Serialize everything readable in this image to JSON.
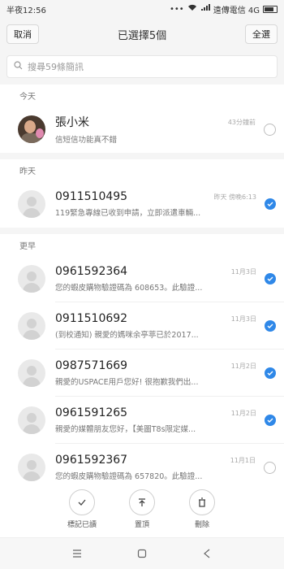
{
  "status": {
    "time": "半夜12:56",
    "carrier": "遠傳電信 4G"
  },
  "header": {
    "cancel_label": "取消",
    "title": "已選擇5個",
    "select_all_label": "全選"
  },
  "search": {
    "placeholder": "搜尋59條簡訊"
  },
  "sections": {
    "today": "今天",
    "yesterday": "昨天",
    "earlier": "更早"
  },
  "messages": [
    {
      "name": "張小米",
      "preview": "信短信功能真不錯",
      "time": "43分鐘前",
      "selected": false
    },
    {
      "name": "0911510495",
      "preview": "119緊急專線已收到申請，立即派遣車輛...",
      "time": "昨天 傍晚6:13",
      "selected": true
    },
    {
      "name": "0961592364",
      "preview": "您的蝦皮購物驗證碼為 608653。此驗證...",
      "time": "11月3日",
      "selected": true
    },
    {
      "name": "0911510692",
      "preview": "(到校通知) 親愛的媽咪余亭葶已於2017...",
      "time": "11月3日",
      "selected": true
    },
    {
      "name": "0987571669",
      "preview": "親愛的USPACE用戶您好! 很抱歉我們出...",
      "time": "11月2日",
      "selected": true
    },
    {
      "name": "0961591265",
      "preview": "親愛的媒體朋友您好，【美圖T8s限定媒...",
      "time": "11月2日",
      "selected": true
    },
    {
      "name": "0961592367",
      "preview": "您的蝦皮購物驗證碼為 657820。此驗證...",
      "time": "11月1日",
      "selected": false
    }
  ],
  "actions": {
    "mark_read": "標記已讀",
    "pin": "置頂",
    "delete": "刪除"
  },
  "colors": {
    "accent": "#2f88e8"
  }
}
